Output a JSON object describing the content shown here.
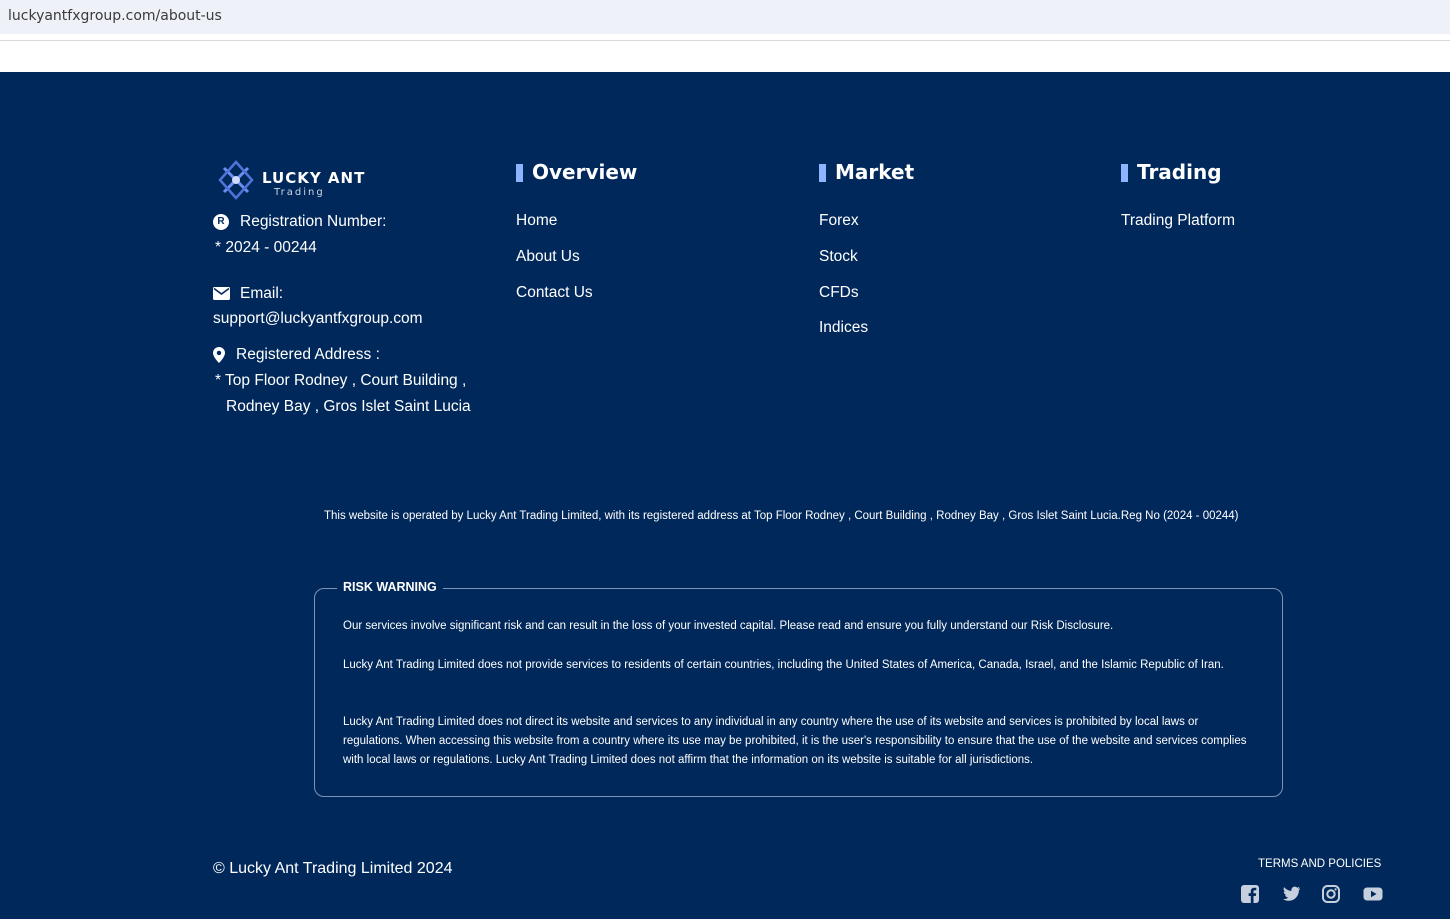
{
  "browser": {
    "url": "luckyantfxgroup.com/about-us"
  },
  "brand": {
    "name": "LUCKY ANT",
    "tagline": "Trading"
  },
  "company_info": {
    "registration_label": "Registration Number:",
    "registration_value": "* 2024 - 00244",
    "email_label": "Email:",
    "email_value": "support@luckyantfxgroup.com",
    "address_label": "Registered Address :",
    "address_line1": "* Top Floor Rodney , Court Building ,",
    "address_line2": "Rodney Bay , Gros Islet Saint Lucia"
  },
  "columns": {
    "overview": {
      "title": "Overview",
      "links": [
        "Home",
        "About Us",
        "Contact Us"
      ]
    },
    "market": {
      "title": "Market",
      "links": [
        "Forex",
        "Stock",
        "CFDs",
        "Indices"
      ]
    },
    "trading": {
      "title": "Trading",
      "links": [
        "Trading Platform"
      ]
    }
  },
  "operated_notice": "This website is operated by Lucky Ant Trading Limited, with its registered address at Top Floor Rodney , Court Building , Rodney Bay , Gros Islet Saint Lucia.Reg No (2024 - 00244)",
  "risk": {
    "title": "RISK WARNING",
    "paragraphs": [
      "Our services involve significant risk and can result in the loss of your invested capital. Please read and ensure you fully understand our Risk Disclosure.",
      "Lucky Ant Trading Limited does not provide services to residents of certain countries, including the United States of America, Canada, Israel, and the Islamic Republic of Iran.",
      "Lucky Ant Trading Limited does not direct its website and services to any individual in any country where the use of its website and services is prohibited by local laws or regulations. When accessing this website from a country where its use may be prohibited, it is the user's responsibility to ensure that the use of the website and services complies with local laws or regulations. Lucky Ant Trading Limited does not affirm that the information on its website is suitable for all jurisdictions."
    ]
  },
  "bottom": {
    "copyright": "© Lucky Ant Trading Limited 2024",
    "terms": "TERMS AND POLICIES",
    "social_icons": [
      "facebook-icon",
      "twitter-icon",
      "instagram-icon",
      "youtube-icon"
    ]
  },
  "colors": {
    "background": "#01285a",
    "accent": "#8fb4ff",
    "text": "#ffffff"
  }
}
